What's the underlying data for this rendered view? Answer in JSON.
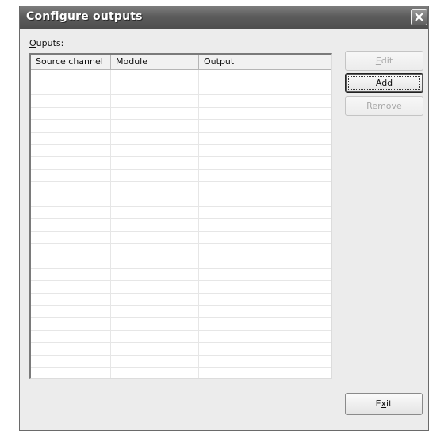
{
  "window": {
    "title": "Configure outputs",
    "close_icon": "close-icon"
  },
  "outputs_label": {
    "accel": "O",
    "rest": "uputs:"
  },
  "table": {
    "columns": [
      "Source channel",
      "Module",
      "Output",
      ""
    ],
    "rows": []
  },
  "buttons": {
    "edit": {
      "accel": "E",
      "rest": "dit",
      "enabled": false
    },
    "add": {
      "accel": "A",
      "rest": "dd",
      "enabled": true
    },
    "remove": {
      "accel": "R",
      "rest": "emove",
      "enabled": false
    },
    "exit": {
      "pre": "E",
      "accel": "x",
      "rest": "it",
      "enabled": true
    }
  },
  "colors": {
    "title_bar": "#5c5c5c",
    "dialog_bg": "#ececec",
    "disabled_text": "#a8a8a8"
  }
}
